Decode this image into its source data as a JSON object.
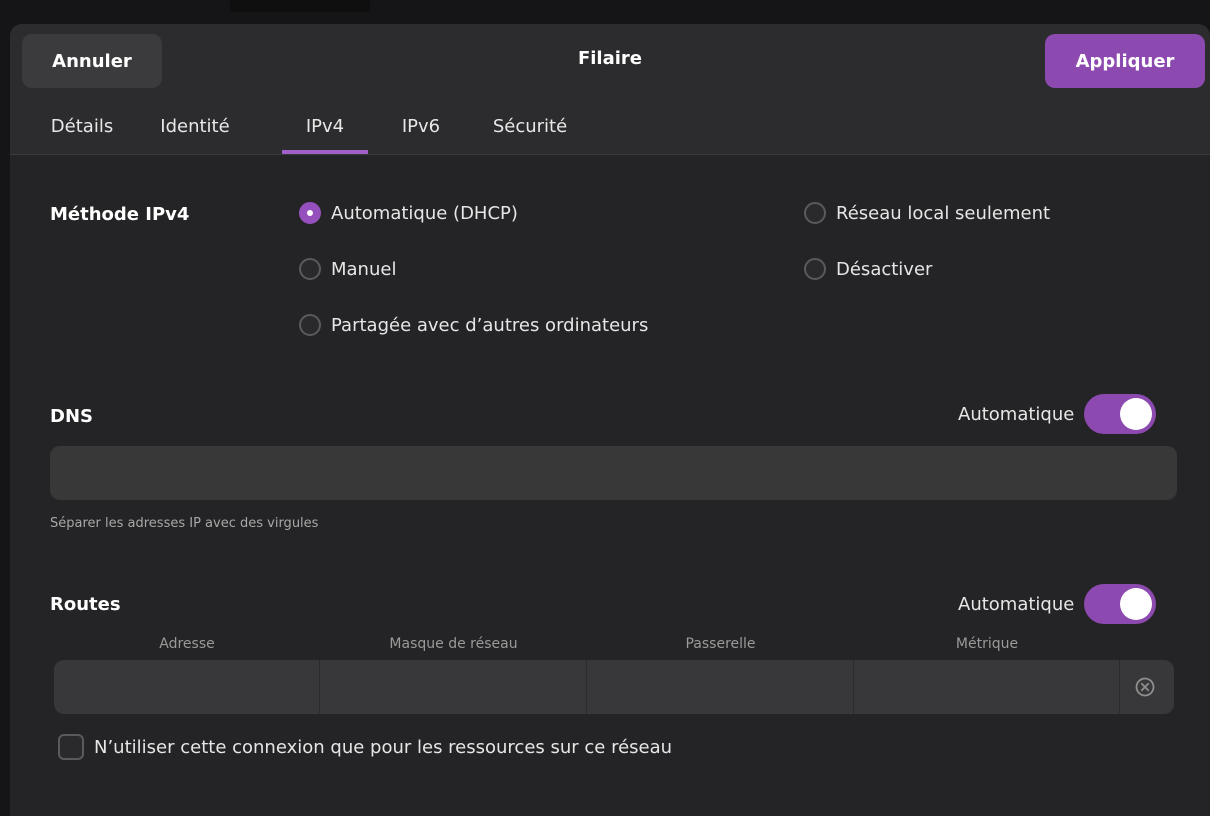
{
  "dialog": {
    "title": "Filaire",
    "cancel_label": "Annuler",
    "apply_label": "Appliquer"
  },
  "tabs": [
    {
      "label": "Détails",
      "active": false
    },
    {
      "label": "Identité",
      "active": false
    },
    {
      "label": "IPv4",
      "active": true
    },
    {
      "label": "IPv6",
      "active": false
    },
    {
      "label": "Sécurité",
      "active": false
    }
  ],
  "ipv4_method": {
    "label": "Méthode IPv4",
    "options": [
      {
        "label": "Automatique (DHCP)",
        "checked": true
      },
      {
        "label": "Réseau local seulement",
        "checked": false
      },
      {
        "label": "Manuel",
        "checked": false
      },
      {
        "label": "Désactiver",
        "checked": false
      },
      {
        "label": "Partagée avec d’autres ordinateurs",
        "checked": false
      }
    ]
  },
  "dns": {
    "label": "DNS",
    "auto_label": "Automatique",
    "auto_on": true,
    "value": "",
    "hint": "Séparer les adresses IP avec des virgules"
  },
  "routes": {
    "label": "Routes",
    "auto_label": "Automatique",
    "auto_on": true,
    "columns": [
      "Adresse",
      "Masque de réseau",
      "Passerelle",
      "Métrique"
    ]
  },
  "only_local": {
    "label": "N’utiliser cette connexion que pour les ressources sur ce réseau",
    "checked": false
  },
  "colors": {
    "accent": "#8c4ab0",
    "background": "#242426"
  }
}
